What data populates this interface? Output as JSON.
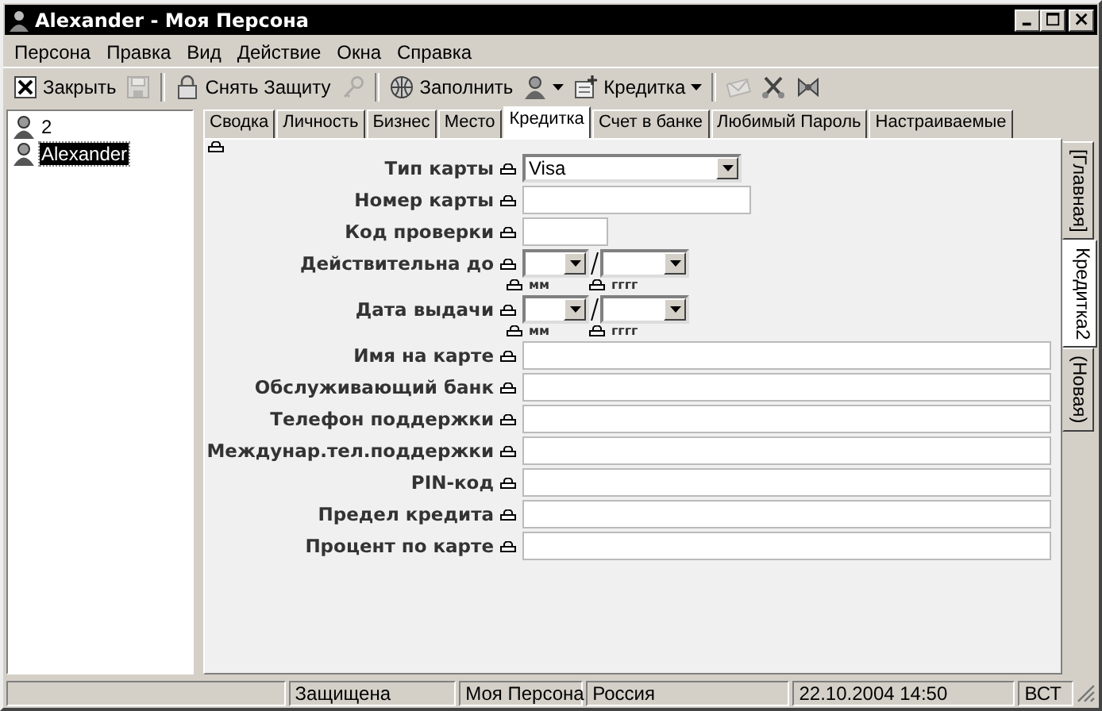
{
  "window": {
    "title": "Alexander - Моя Персона"
  },
  "menu": [
    "Персона",
    "Правка",
    "Вид",
    "Действие",
    "Окна",
    "Справка"
  ],
  "toolbar": [
    {
      "kind": "button",
      "label": "Закрыть",
      "disabled": false
    },
    {
      "kind": "icon",
      "disabled": true
    },
    {
      "kind": "separator"
    },
    {
      "kind": "button",
      "label": "Снять Защиту",
      "disabled": false
    },
    {
      "kind": "icon",
      "disabled": true
    },
    {
      "kind": "separator"
    },
    {
      "kind": "button",
      "label": "Заполнить",
      "disabled": false
    },
    {
      "kind": "dropdown"
    },
    {
      "kind": "dropdown",
      "label": "Кредитка"
    },
    {
      "kind": "separator"
    },
    {
      "kind": "icon",
      "disabled": true
    },
    {
      "kind": "icon",
      "disabled": false
    },
    {
      "kind": "icon",
      "disabled": false
    }
  ],
  "sidebar": {
    "items": [
      {
        "label": "2",
        "selected": false
      },
      {
        "label": "Alexander",
        "selected": true
      }
    ]
  },
  "tabs": [
    {
      "label": "Сводка",
      "selected": false
    },
    {
      "label": "Личность",
      "selected": false
    },
    {
      "label": "Бизнес",
      "selected": false
    },
    {
      "label": "Место",
      "selected": false
    },
    {
      "label": "Кредитка",
      "selected": true
    },
    {
      "label": "Счет в банке",
      "selected": false
    },
    {
      "label": "Любимый Пароль",
      "selected": false
    },
    {
      "label": "Настраиваемые",
      "selected": false
    }
  ],
  "side_tabs": [
    {
      "label": "[Главная]",
      "selected": false
    },
    {
      "label": "Кредитка2",
      "selected": true
    },
    {
      "label": "(Новая)",
      "selected": false
    }
  ],
  "form": {
    "fields": [
      {
        "kind": "select",
        "label": "Тип карты",
        "value": "Visa"
      },
      {
        "kind": "number",
        "label": "Номер карты"
      },
      {
        "kind": "code",
        "label": "Код проверки"
      },
      {
        "kind": "date",
        "label": "Действительна до",
        "month_label": "мм",
        "year_label": "гггг"
      },
      {
        "kind": "date",
        "label": "Дата выдачи",
        "month_label": "мм",
        "year_label": "гггг"
      },
      {
        "kind": "text",
        "label": "Имя на карте"
      },
      {
        "kind": "text",
        "label": "Обслуживающий банк"
      },
      {
        "kind": "text",
        "label": "Телефон поддержки"
      },
      {
        "kind": "text",
        "label": "Междунар.тел.поддержки"
      },
      {
        "kind": "text",
        "label": "PIN-код"
      },
      {
        "kind": "text",
        "label": "Предел кредита"
      },
      {
        "kind": "text",
        "label": "Процент по карте"
      }
    ]
  },
  "status_bar": [
    "Защищена",
    "Моя Персона",
    "Россия",
    "22.10.2004 14:50",
    "ВСТ"
  ]
}
